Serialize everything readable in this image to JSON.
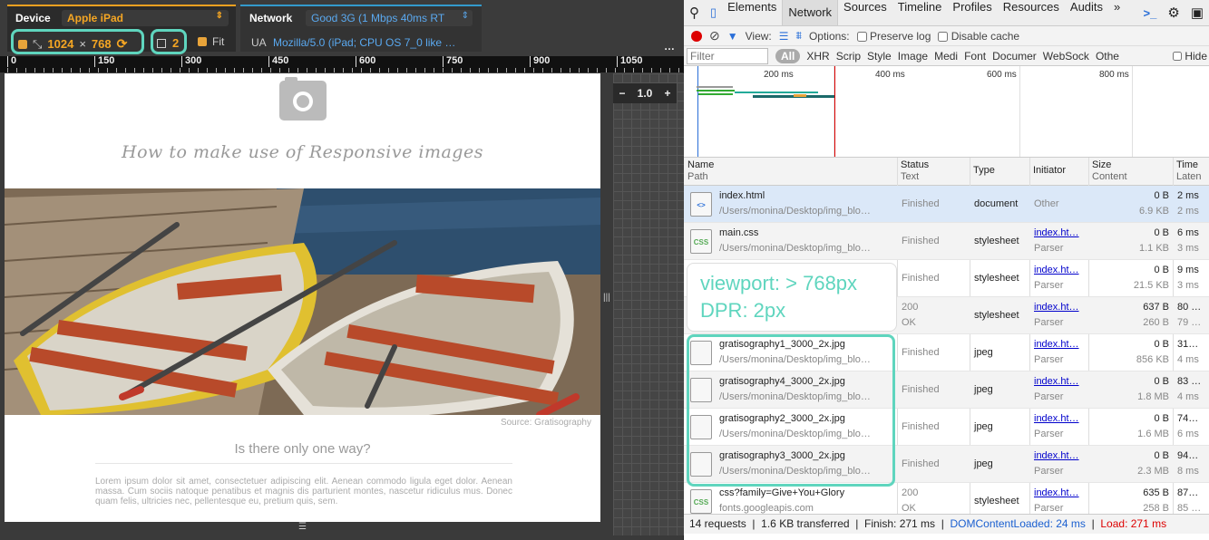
{
  "device": {
    "device_label": "Device",
    "device_value": "Apple iPad",
    "width": "1024",
    "times": "×",
    "height": "768",
    "dpr": "2",
    "fit_label": "Fit"
  },
  "network": {
    "label": "Network",
    "value": "Good 3G (1 Mbps 40ms RT",
    "ua_label": "UA",
    "ua_value": "Mozilla/5.0 (iPad; CPU OS 7_0 like …"
  },
  "ruler": [
    "0",
    "150",
    "300",
    "450",
    "600",
    "750",
    "900",
    "1050"
  ],
  "zoom": {
    "minus": "−",
    "value": "1.0",
    "plus": "+"
  },
  "page": {
    "title": "How to make use of Responsive images",
    "source": "Source: Gratisography",
    "subtitle": "Is there only one way?",
    "lorem": "Lorem ipsum dolor sit amet, consectetuer adipiscing elit. Aenean commodo ligula eget dolor. Aenean massa. Cum sociis natoque penatibus et magnis dis parturient montes, nascetur ridiculus mus. Donec quam felis, ultricies nec, pellentesque eu, pretium quis, sem."
  },
  "devtools": {
    "tabs": [
      "Elements",
      "Network",
      "Sources",
      "Timeline",
      "Profiles",
      "Resources",
      "Audits",
      "»"
    ],
    "active_tab": "Network",
    "view_label": "View:",
    "options_label": "Options:",
    "preserve_log": "Preserve log",
    "disable_cache": "Disable cache",
    "filter_placeholder": "Filter",
    "filter_types": [
      "All",
      "XHR",
      "Scrip",
      "Style",
      "Image",
      "Medi",
      "Font",
      "Documer",
      "WebSock",
      "Othe"
    ],
    "hide_label": "Hide",
    "timeline_labels": [
      "200 ms",
      "400 ms",
      "600 ms",
      "800 ms"
    ]
  },
  "columns": [
    {
      "main": "Name",
      "sub": "Path"
    },
    {
      "main": "Status",
      "sub": "Text"
    },
    {
      "main": "Type",
      "sub": ""
    },
    {
      "main": "Initiator",
      "sub": ""
    },
    {
      "main": "Size",
      "sub": "Content"
    },
    {
      "main": "Time",
      "sub": "Laten"
    }
  ],
  "rows": [
    {
      "name": "index.html",
      "path": "/Users/monina/Desktop/img_blo…",
      "status": "Finished",
      "status2": "",
      "type": "document",
      "initiator": "Other",
      "init2": "",
      "size": "0 B",
      "content": "6.9 KB",
      "time": "2 ms",
      "latency": "2 ms",
      "icon": "html"
    },
    {
      "name": "main.css",
      "path": "/Users/monina/Desktop/img_blo…",
      "status": "Finished",
      "status2": "",
      "type": "stylesheet",
      "initiator": "index.ht…",
      "init2": "Parser",
      "size": "0 B",
      "content": "1.1 KB",
      "time": "6 ms",
      "latency": "3 ms",
      "icon": "css"
    },
    {
      "name": "",
      "path": "",
      "status": "Finished",
      "status2": "",
      "type": "stylesheet",
      "initiator": "index.ht…",
      "init2": "Parser",
      "size": "0 B",
      "content": "21.5 KB",
      "time": "9 ms",
      "latency": "3 ms",
      "icon": "css"
    },
    {
      "name": "",
      "path": "",
      "status": "200",
      "status2": "OK",
      "type": "stylesheet",
      "initiator": "index.ht…",
      "init2": "Parser",
      "size": "637 B",
      "content": "260 B",
      "time": "80 …",
      "latency": "79 …",
      "icon": "css"
    },
    {
      "name": "gratisography1_3000_2x.jpg",
      "path": "/Users/monina/Desktop/img_blo…",
      "status": "Finished",
      "status2": "",
      "type": "jpeg",
      "initiator": "index.ht…",
      "init2": "Parser",
      "size": "0 B",
      "content": "856 KB",
      "time": "31…",
      "latency": "4 ms",
      "icon": "img"
    },
    {
      "name": "gratisography4_3000_2x.jpg",
      "path": "/Users/monina/Desktop/img_blo…",
      "status": "Finished",
      "status2": "",
      "type": "jpeg",
      "initiator": "index.ht…",
      "init2": "Parser",
      "size": "0 B",
      "content": "1.8 MB",
      "time": "83 …",
      "latency": "4 ms",
      "icon": "img"
    },
    {
      "name": "gratisography2_3000_2x.jpg",
      "path": "/Users/monina/Desktop/img_blo…",
      "status": "Finished",
      "status2": "",
      "type": "jpeg",
      "initiator": "index.ht…",
      "init2": "Parser",
      "size": "0 B",
      "content": "1.6 MB",
      "time": "74…",
      "latency": "6 ms",
      "icon": "img"
    },
    {
      "name": "gratisography3_3000_2x.jpg",
      "path": "/Users/monina/Desktop/img_blo…",
      "status": "Finished",
      "status2": "",
      "type": "jpeg",
      "initiator": "index.ht…",
      "init2": "Parser",
      "size": "0 B",
      "content": "2.3 MB",
      "time": "94…",
      "latency": "8 ms",
      "icon": "img"
    },
    {
      "name": "css?family=Give+You+Glory",
      "path": "fonts.googleapis.com",
      "status": "200",
      "status2": "OK",
      "type": "stylesheet",
      "initiator": "index.ht…",
      "init2": "Parser",
      "size": "635 B",
      "content": "258 B",
      "time": "87…",
      "latency": "85 …",
      "icon": "css"
    }
  ],
  "status_bar": {
    "requests": "14 requests",
    "transferred": "1.6 KB transferred",
    "finish": "Finish: 271 ms",
    "dcl": "DOMContentLoaded: 24 ms",
    "load": "Load: 271 ms"
  },
  "callout": {
    "line1": "viewport: > 768px",
    "line2": "DPR: 2px"
  },
  "colors": {
    "accent": "#5fd5be",
    "orange": "#f5a623",
    "blue": "#1a5fd0",
    "red": "#d00"
  }
}
